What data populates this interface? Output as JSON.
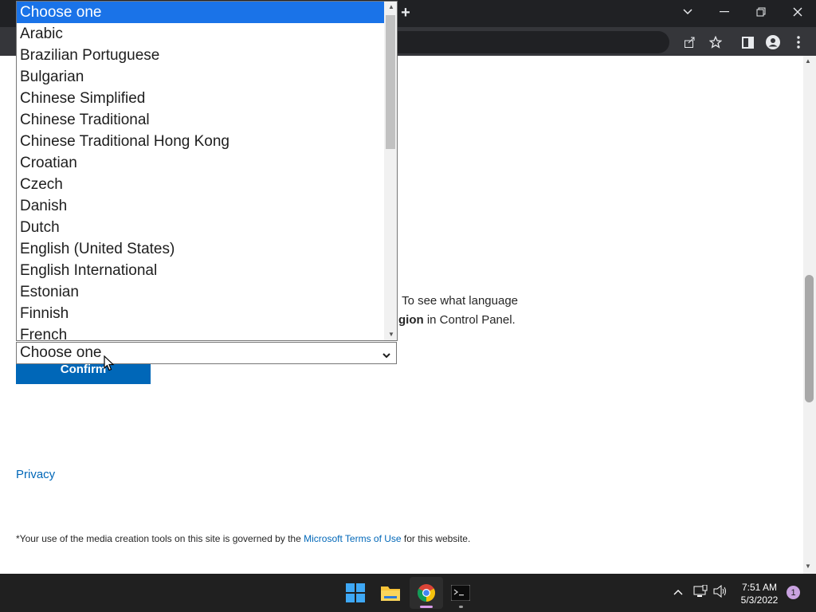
{
  "browser": {
    "new_tab_symbol": "+",
    "icons": [
      "tab-search-icon",
      "minimize-icon",
      "restore-icon",
      "close-icon",
      "share-icon",
      "star-icon",
      "sidebar-icon",
      "profile-icon",
      "menu-icon"
    ]
  },
  "page": {
    "info_line1": ". To see what language",
    "info_line2_bold": "gion",
    "info_line2_rest": " in Control Panel.",
    "confirm_label": "Confirm",
    "privacy_label": "Privacy",
    "footnote_before": "*Your use of the media creation tools on this site is governed by the ",
    "footnote_link": "Microsoft Terms of Use",
    "footnote_after": " for this website."
  },
  "select": {
    "selected_value": "Choose one",
    "options": [
      "Choose one",
      "Arabic",
      "Brazilian Portuguese",
      "Bulgarian",
      "Chinese Simplified",
      "Chinese Traditional",
      "Chinese Traditional Hong Kong",
      "Croatian",
      "Czech",
      "Danish",
      "Dutch",
      "English (United States)",
      "English International",
      "Estonian",
      "Finnish",
      "French"
    ],
    "highlighted_index": 0
  },
  "taskbar": {
    "apps": [
      "windows-start-icon",
      "file-explorer-icon",
      "chrome-icon",
      "terminal-icon"
    ],
    "time": "7:51 AM",
    "date": "5/3/2022",
    "notification_count": "1"
  },
  "colors": {
    "accent": "#0067b8",
    "selection": "#1a73e8",
    "taskbar": "#202020",
    "chrome_dark": "#202124"
  }
}
